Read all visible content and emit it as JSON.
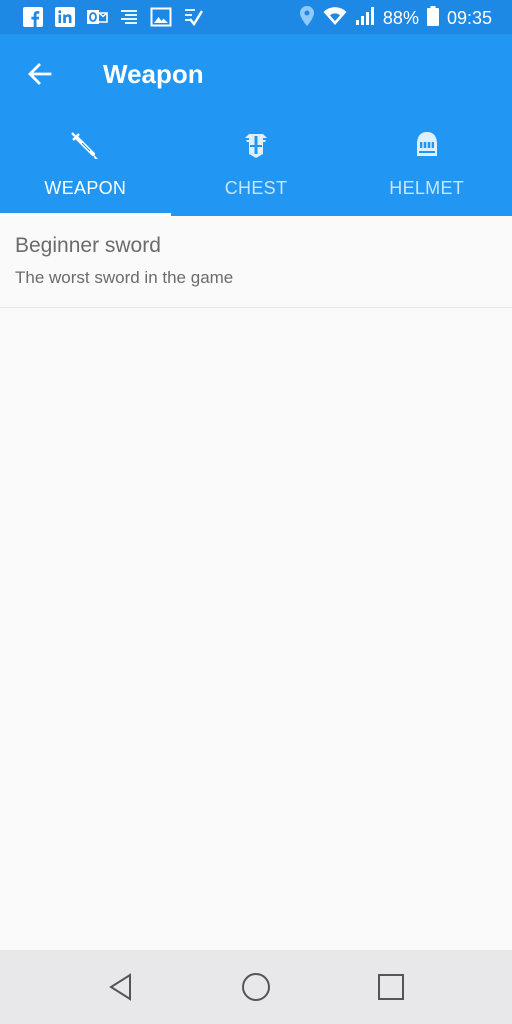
{
  "status_bar": {
    "battery_percent": "88%",
    "time": "09:35",
    "left_icons": [
      "facebook-icon",
      "linkedin-icon",
      "outlook-icon",
      "notes-icon",
      "gallery-icon",
      "tasks-icon"
    ],
    "right_icons": [
      "location-icon",
      "wifi-icon",
      "signal-icon",
      "battery-icon"
    ]
  },
  "app_bar": {
    "title": "Weapon"
  },
  "tabs": [
    {
      "label": "WEAPON",
      "icon": "sword-icon",
      "selected": true
    },
    {
      "label": "CHEST",
      "icon": "chest-armor-icon",
      "selected": false
    },
    {
      "label": "HELMET",
      "icon": "helmet-icon",
      "selected": false
    }
  ],
  "items": [
    {
      "title": "Beginner sword",
      "subtitle": "The worst sword in the game"
    }
  ],
  "colors": {
    "status_bar": "#1e88e5",
    "primary": "#2196f3",
    "background": "#fafafa",
    "nav_bar": "#e8e8ea"
  }
}
